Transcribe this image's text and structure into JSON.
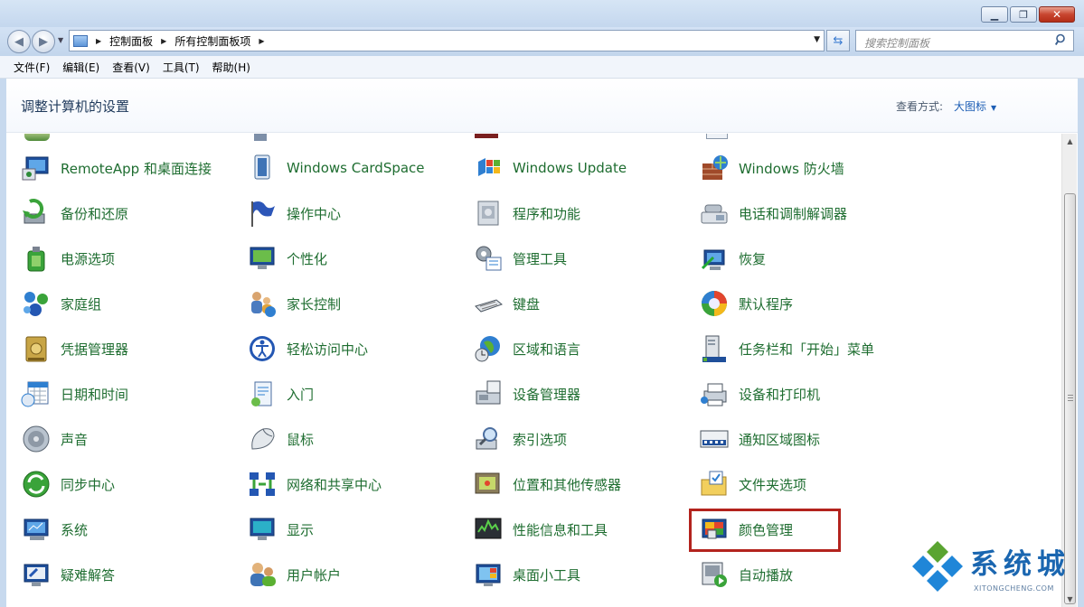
{
  "window": {
    "minimize_glyph": "▁",
    "maximize_glyph": "❐",
    "close_glyph": "✕"
  },
  "address_bar": {
    "breadcrumbs": [
      "控制面板",
      "所有控制面板项"
    ],
    "search_placeholder": "搜索控制面板"
  },
  "menu": [
    "文件(F)",
    "编辑(E)",
    "查看(V)",
    "工具(T)",
    "帮助(H)"
  ],
  "header": {
    "title": "调整计算机的设置",
    "view_label": "查看方式:",
    "view_value": "大图标"
  },
  "items": [
    {
      "label": "RemoteApp 和桌面连接",
      "icon": "remoteapp-icon"
    },
    {
      "label": "Windows CardSpace",
      "icon": "cardspace-icon"
    },
    {
      "label": "Windows Update",
      "icon": "windows-update-icon"
    },
    {
      "label": "Windows 防火墙",
      "icon": "firewall-icon"
    },
    {
      "label": "备份和还原",
      "icon": "backup-icon"
    },
    {
      "label": "操作中心",
      "icon": "action-center-flag-icon"
    },
    {
      "label": "程序和功能",
      "icon": "programs-icon"
    },
    {
      "label": "电话和调制解调器",
      "icon": "phone-modem-icon"
    },
    {
      "label": "电源选项",
      "icon": "power-icon"
    },
    {
      "label": "个性化",
      "icon": "personalization-icon"
    },
    {
      "label": "管理工具",
      "icon": "admin-tools-icon"
    },
    {
      "label": "恢复",
      "icon": "recovery-icon"
    },
    {
      "label": "家庭组",
      "icon": "homegroup-icon"
    },
    {
      "label": "家长控制",
      "icon": "parental-controls-icon"
    },
    {
      "label": "键盘",
      "icon": "keyboard-icon"
    },
    {
      "label": "默认程序",
      "icon": "default-programs-icon"
    },
    {
      "label": "凭据管理器",
      "icon": "credential-manager-icon"
    },
    {
      "label": "轻松访问中心",
      "icon": "ease-of-access-icon"
    },
    {
      "label": "区域和语言",
      "icon": "region-language-icon"
    },
    {
      "label": "任务栏和「开始」菜单",
      "icon": "taskbar-icon"
    },
    {
      "label": "日期和时间",
      "icon": "date-time-icon"
    },
    {
      "label": "入门",
      "icon": "getting-started-icon"
    },
    {
      "label": "设备管理器",
      "icon": "device-manager-icon"
    },
    {
      "label": "设备和打印机",
      "icon": "devices-printers-icon"
    },
    {
      "label": "声音",
      "icon": "sound-icon"
    },
    {
      "label": "鼠标",
      "icon": "mouse-icon"
    },
    {
      "label": "索引选项",
      "icon": "indexing-icon"
    },
    {
      "label": "通知区域图标",
      "icon": "notification-area-icon"
    },
    {
      "label": "同步中心",
      "icon": "sync-center-icon"
    },
    {
      "label": "网络和共享中心",
      "icon": "network-sharing-icon"
    },
    {
      "label": "位置和其他传感器",
      "icon": "location-sensors-icon"
    },
    {
      "label": "文件夹选项",
      "icon": "folder-options-icon"
    },
    {
      "label": "系统",
      "icon": "system-icon"
    },
    {
      "label": "显示",
      "icon": "display-icon"
    },
    {
      "label": "性能信息和工具",
      "icon": "performance-icon"
    },
    {
      "label": "颜色管理",
      "icon": "color-management-icon"
    },
    {
      "label": "疑难解答",
      "icon": "troubleshooting-icon"
    },
    {
      "label": "用户帐户",
      "icon": "user-accounts-icon"
    },
    {
      "label": "桌面小工具",
      "icon": "gadgets-icon"
    },
    {
      "label": "自动播放",
      "icon": "autoplay-icon"
    }
  ],
  "highlighted_item": "颜色管理",
  "watermark": {
    "text": "系统城",
    "subtext": "XITONGCHENG.COM"
  }
}
